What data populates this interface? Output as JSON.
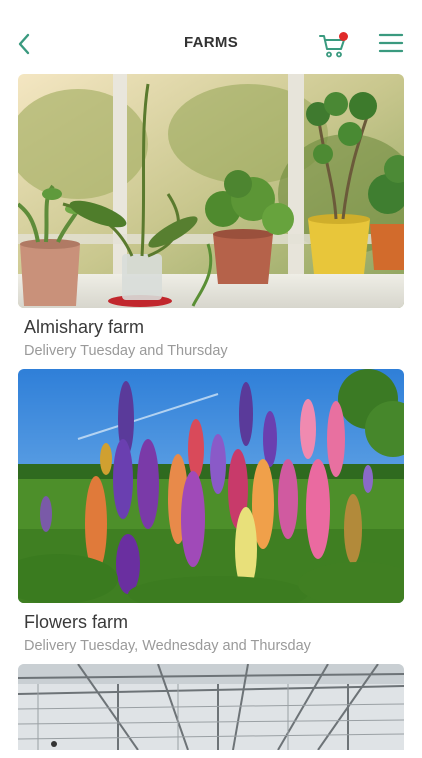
{
  "header": {
    "title": "FARMS",
    "back_icon": "chevron-left-icon",
    "cart_icon": "cart-icon",
    "menu_icon": "hamburger-menu-icon",
    "accent_color": "#3a9a7f",
    "badge_color": "#e02a2a"
  },
  "farms": [
    {
      "name": "Almishary farm",
      "delivery": "Delivery Tuesday and Thursday"
    },
    {
      "name": "Flowers farm",
      "delivery": "Delivery Tuesday, Wednesday and Thursday"
    },
    {
      "name": "",
      "delivery": ""
    }
  ]
}
